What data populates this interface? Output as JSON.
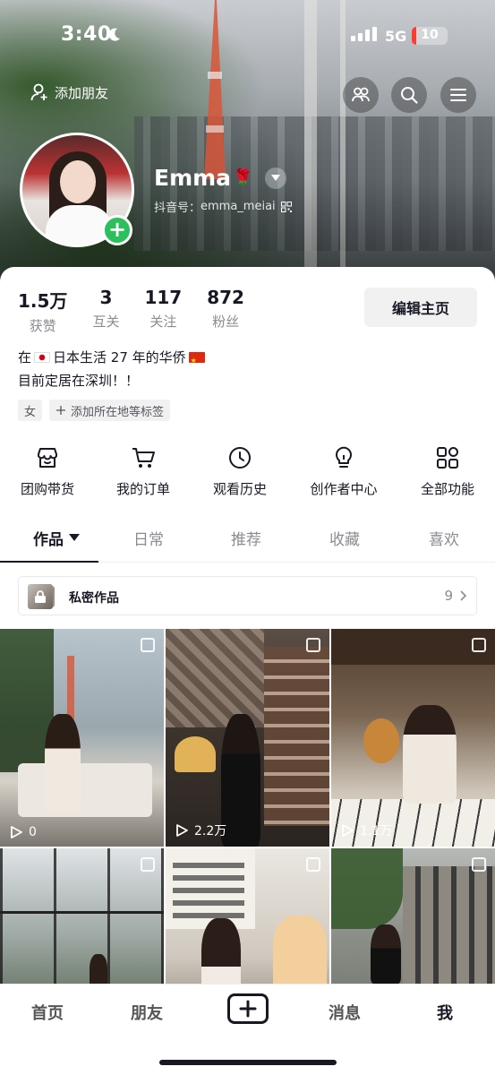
{
  "status": {
    "time": "3:40",
    "network": "5G",
    "battery": "10"
  },
  "header": {
    "add_friend_label": "添加朋友"
  },
  "profile": {
    "name": "Emma",
    "name_emoji": "🌹",
    "account_prefix": "抖音号：",
    "account_id": "emma_meiai"
  },
  "stats": [
    {
      "value": "1.5万",
      "label": "获赞"
    },
    {
      "value": "3",
      "label": "互关"
    },
    {
      "value": "117",
      "label": "关注"
    },
    {
      "value": "872",
      "label": "粉丝"
    }
  ],
  "edit_button": "编辑主页",
  "bio": {
    "line1_a": "在",
    "line1_b": "日本生活 27 年的华侨",
    "line2": "目前定居在深圳！！"
  },
  "tags": {
    "gender": "女",
    "add_location": "添加所在地等标签"
  },
  "features": [
    {
      "label": "团购带货",
      "icon": "shop-icon"
    },
    {
      "label": "我的订单",
      "icon": "cart-icon"
    },
    {
      "label": "观看历史",
      "icon": "clock-icon"
    },
    {
      "label": "创作者中心",
      "icon": "lightbulb-icon"
    },
    {
      "label": "全部功能",
      "icon": "apps-icon"
    }
  ],
  "tabs": [
    "作品",
    "日常",
    "推荐",
    "收藏",
    "喜欢"
  ],
  "private_works": {
    "label": "私密作品",
    "count": "9"
  },
  "videos": [
    {
      "plays": "0"
    },
    {
      "plays": "2.2万"
    },
    {
      "plays": "1.1万"
    },
    {
      "plays": ""
    },
    {
      "plays": ""
    },
    {
      "plays": ""
    }
  ],
  "tabbar": {
    "home": "首页",
    "friends": "朋友",
    "messages": "消息",
    "me": "我"
  },
  "colors": {
    "green_add": "#2bc05b",
    "text_primary": "#161823",
    "text_secondary": "#8a8b91"
  }
}
